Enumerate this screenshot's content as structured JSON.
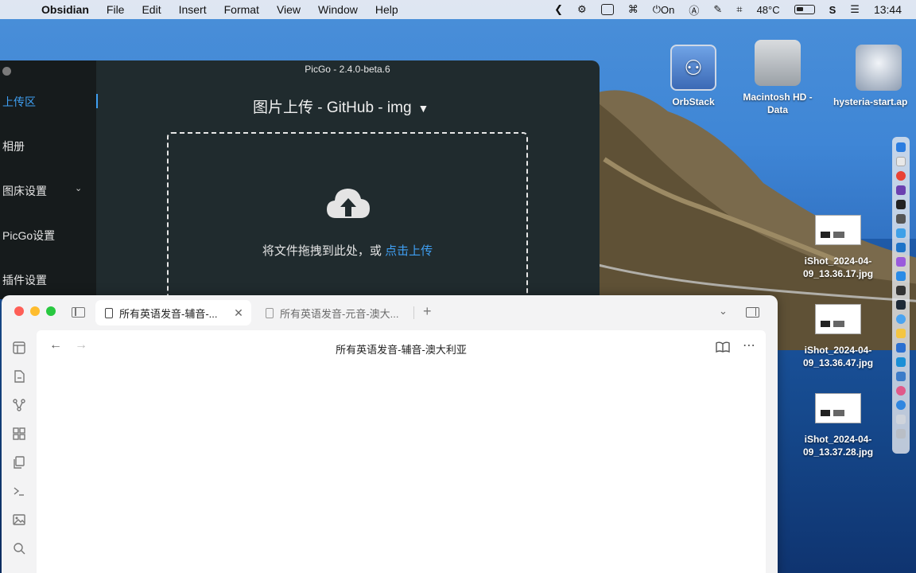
{
  "menubar": {
    "app_name": "Obsidian",
    "menus": [
      "File",
      "Edit",
      "Insert",
      "Format",
      "View",
      "Window",
      "Help"
    ],
    "focus_status": "On",
    "temperature": "48°C",
    "time": "13:44"
  },
  "desktop": {
    "icons": [
      {
        "label": "OrbStack",
        "icon": "orbstack-icon"
      },
      {
        "label": "Macintosh HD - Data",
        "icon": "hard-drive-icon"
      },
      {
        "label": "hysteria-start.ap",
        "icon": "app-icon"
      },
      {
        "label": "iShot_2024-04-09_13.36.17.jpg",
        "icon": "image-file-icon"
      },
      {
        "label": "iShot_2024-04-09_13.36.47.jpg",
        "icon": "image-file-icon"
      },
      {
        "label": "iShot_2024-04-09_13.37.28.jpg",
        "icon": "image-file-icon"
      }
    ]
  },
  "picgo": {
    "window_title": "PicGo - 2.4.0-beta.6",
    "sidebar": [
      {
        "label": "上传区",
        "active": true
      },
      {
        "label": "相册"
      },
      {
        "label": "图床设置",
        "has_submenu": true
      },
      {
        "label": "PicGo设置"
      },
      {
        "label": "插件设置"
      }
    ],
    "heading": "图片上传 - GitHub - img",
    "drop_text": "将文件拖拽到此处，或",
    "drop_link": "点击上传",
    "accent_color": "#3f9ff2"
  },
  "obsidian": {
    "tabs": [
      {
        "label": "所有英语发音-辅音-...",
        "active": true
      },
      {
        "label": "所有英语发音-元音-澳大...",
        "active": false
      }
    ],
    "view_title": "所有英语发音-辅音-澳大利亚",
    "ribbon_icons": [
      "layout-icon",
      "new-note-icon",
      "graph-icon",
      "blocks-icon",
      "copy-icon",
      "terminal-icon",
      "image-icon",
      "search-icon"
    ]
  }
}
